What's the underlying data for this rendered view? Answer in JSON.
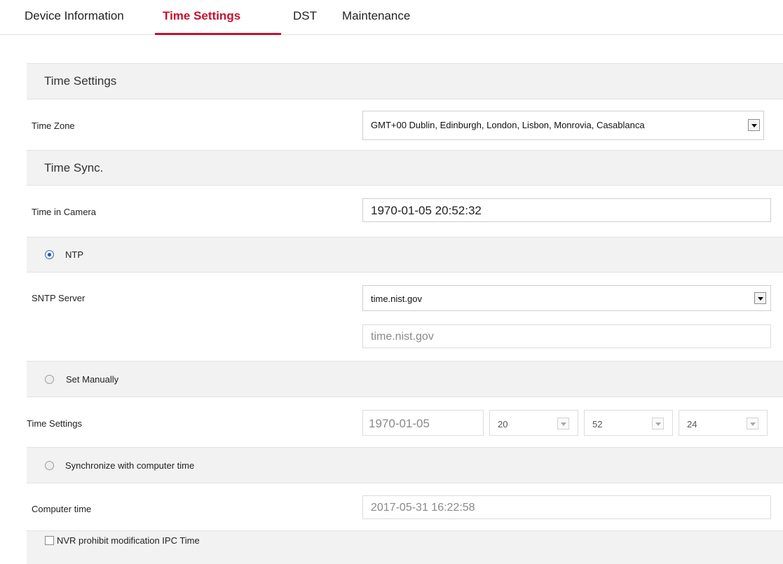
{
  "tabs": [
    {
      "label": "Device Information"
    },
    {
      "label": "Time Settings"
    },
    {
      "label": "DST"
    },
    {
      "label": "Maintenance"
    }
  ],
  "sections": {
    "time_settings_title": "Time Settings",
    "time_sync_title": "Time Sync."
  },
  "time_zone": {
    "label": "Time Zone",
    "value": "GMT+00 Dublin, Edinburgh, London, Lisbon, Monrovia, Casablanca"
  },
  "time_in_camera": {
    "label": "Time in Camera",
    "value": "1970-01-05 20:52:32"
  },
  "ntp": {
    "label": "NTP",
    "selected": true,
    "sntp_label": "SNTP Server",
    "sntp_value": "time.nist.gov",
    "server_address": "time.nist.gov"
  },
  "manual": {
    "label": "Set Manually",
    "time_label": "Time Settings",
    "date": "1970-01-05",
    "hour": "20",
    "minute": "52",
    "second": "24"
  },
  "computer_sync": {
    "label": "Synchronize with computer time",
    "time_label": "Computer time",
    "time_value": "2017-05-31 16:22:58"
  },
  "nvr": {
    "label": "NVR prohibit modification IPC Time",
    "checked": false
  },
  "colors": {
    "accent": "#c8102e",
    "section_bg": "#f2f2f2"
  }
}
